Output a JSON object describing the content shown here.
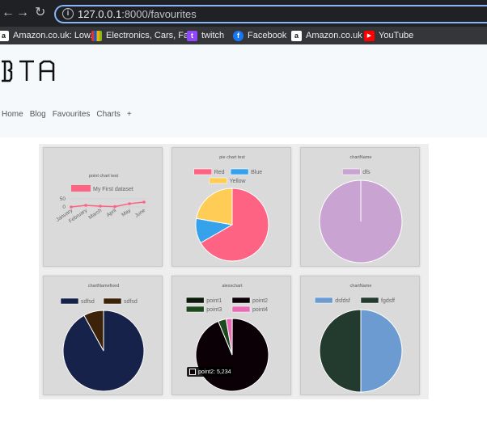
{
  "browser": {
    "url_host": "127.0.0.1",
    "url_rest": ":8000/favourites"
  },
  "bookmarks": [
    {
      "label": "Amazon.co.uk: Low...",
      "icon": "amazon-icon"
    },
    {
      "label": "Electronics, Cars, Fa...",
      "icon": "ebay-icon"
    },
    {
      "label": "twitch",
      "icon": "twitch-icon"
    },
    {
      "label": "Facebook",
      "icon": "facebook-icon"
    },
    {
      "label": "Amazon.co.uk",
      "icon": "amazon-icon"
    },
    {
      "label": "YouTube",
      "icon": "youtube-icon"
    }
  ],
  "site": {
    "logo_text": "BTA",
    "nav": [
      "Home",
      "Blog",
      "Favourites",
      "Charts",
      "+"
    ]
  },
  "chart_data": [
    {
      "type": "line",
      "title": "point chart test",
      "categories": [
        "January",
        "February",
        "March",
        "April",
        "May",
        "June"
      ],
      "series": [
        {
          "name": "My First dataset",
          "values": [
            0,
            10,
            5,
            2,
            20,
            30
          ],
          "color": "#ff6384"
        }
      ],
      "ylim": [
        0,
        50
      ],
      "yticks": [
        "50",
        "0"
      ]
    },
    {
      "type": "pie",
      "title": "pie chart test",
      "labels": [
        "Red",
        "Blue",
        "Yellow"
      ],
      "values": [
        300,
        50,
        100
      ],
      "colors": [
        "#ff6384",
        "#36a2eb",
        "#ffcd56"
      ]
    },
    {
      "type": "pie",
      "title": "chartName",
      "labels": [
        "dfs"
      ],
      "values": [
        100
      ],
      "colors": [
        "#c9a3d1"
      ]
    },
    {
      "type": "pie",
      "title": "chartNamefixed",
      "labels": [
        "sdfsd",
        "sdfsd"
      ],
      "values": [
        92,
        8
      ],
      "colors": [
        "#16224a",
        "#3b2208"
      ]
    },
    {
      "type": "pie",
      "title": "alexschart",
      "labels": [
        "point1",
        "point2",
        "point3",
        "point4"
      ],
      "values": [
        3,
        5234,
        200,
        150
      ],
      "colors": [
        "#0c1a0c",
        "#0a0005",
        "#1d4a1d",
        "#ea6bb4"
      ],
      "tooltip": "point2: 5,234"
    },
    {
      "type": "pie",
      "title": "chartName",
      "labels": [
        "dsfdsf",
        "fgdsff"
      ],
      "values": [
        50,
        50
      ],
      "colors": [
        "#6b9bd1",
        "#233a2e"
      ]
    }
  ]
}
